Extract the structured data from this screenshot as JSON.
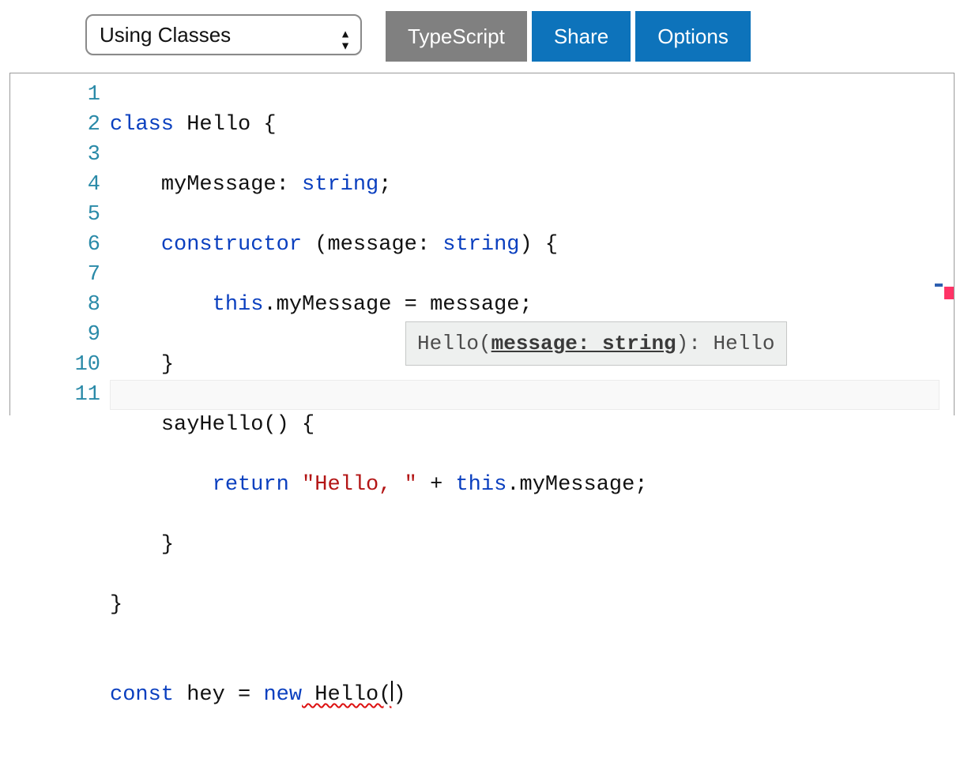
{
  "toolbar": {
    "example_selected": "Using Classes",
    "tabs": {
      "typescript": "TypeScript",
      "share": "Share",
      "options": "Options"
    }
  },
  "editor": {
    "line_numbers": [
      "1",
      "2",
      "3",
      "4",
      "5",
      "6",
      "7",
      "8",
      "9",
      "10",
      "11"
    ],
    "code": {
      "l1": {
        "kw_class": "class",
        "name": " Hello {"
      },
      "l2": {
        "indent": "    ",
        "prop": "myMessage: ",
        "type": "string",
        "semi": ";"
      },
      "l3": {
        "indent": "    ",
        "kw_ctor": "constructor",
        "sig": " (message: ",
        "type": "string",
        "rest": ") {"
      },
      "l4": {
        "indent": "        ",
        "kw_this": "this",
        "rest": ".myMessage = message;"
      },
      "l5": {
        "indent": "    ",
        "brace": "}"
      },
      "l6": {
        "indent": "    ",
        "name": "sayHello() {"
      },
      "l7": {
        "indent": "        ",
        "kw_return": "return",
        "sp": " ",
        "str": "\"Hello, \"",
        "plus": " + ",
        "kw_this": "this",
        "rest": ".myMessage;"
      },
      "l8": {
        "indent": "    ",
        "brace": "}"
      },
      "l9": {
        "brace": "}"
      },
      "l10": {
        "blank": ""
      },
      "l11": {
        "kw_const": "const",
        "mid": " hey = ",
        "kw_new": "new",
        "err": " Hello(",
        "close": ")"
      }
    },
    "signature_help": {
      "callee": "Hello(",
      "active_param": "message: string",
      "after": "): Hello"
    }
  }
}
